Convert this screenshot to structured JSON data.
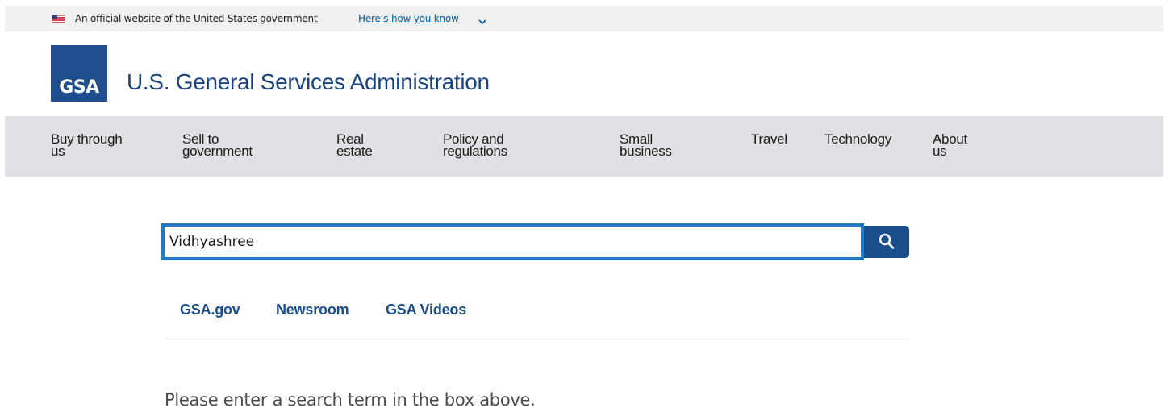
{
  "gov_banner": {
    "official_text": "An official website of the United States government",
    "how_you_know_link": "Here’s how you know",
    "icons": [
      "us-flag-icon",
      "chevron-down-icon"
    ]
  },
  "header": {
    "logo_text": "GSA",
    "title": "U.S. General Services Administration"
  },
  "nav": {
    "items": [
      {
        "label": "Buy through\nus"
      },
      {
        "label": "Sell to\ngovernment"
      },
      {
        "label": "Real\nestate"
      },
      {
        "label": "Policy and\nregulations"
      },
      {
        "label": "Small\nbusiness"
      },
      {
        "label": "Travel"
      },
      {
        "label": "Technology"
      },
      {
        "label": "About\nus"
      }
    ]
  },
  "search": {
    "value": "Vidhyashree",
    "button_icon": "search-icon"
  },
  "tabs": [
    {
      "label": "GSA.gov"
    },
    {
      "label": "Newsroom"
    },
    {
      "label": "GSA Videos"
    }
  ],
  "message": "Please enter a search term in the box above.",
  "colors": {
    "brand_blue": "#1a4480",
    "link_blue": "#005ea2",
    "focus_blue": "#2378c3",
    "nav_bg": "#dfe1e5",
    "banner_bg": "#f0f0f0"
  }
}
